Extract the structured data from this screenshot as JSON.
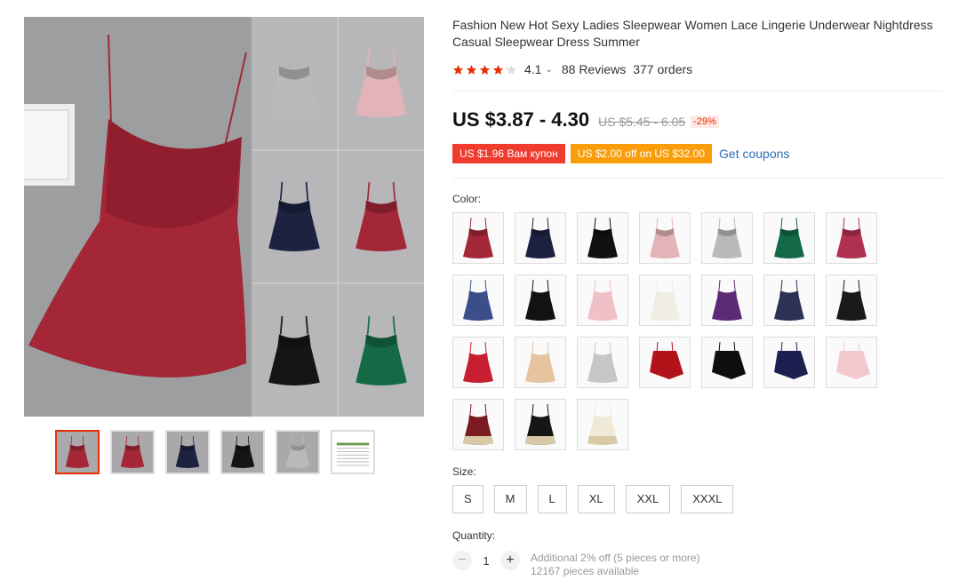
{
  "product": {
    "title": "Fashion New Hot Sexy Ladies Sleepwear Women Lace Lingerie Underwear Nightdress Casual Sleepwear Dress Summer",
    "rating": 4.1,
    "rating_text": "4.1",
    "reviews": "88 Reviews",
    "orders": "377 orders"
  },
  "price": {
    "current": "US $3.87 - 4.30",
    "original": "US $5.45 - 6.05",
    "discount": "-29%"
  },
  "coupons": {
    "coupon1": "US $1.96 Вам купон",
    "coupon2": "US $2.00 off on US $32.00",
    "get_label": "Get coupons"
  },
  "color_label": "Color:",
  "colors": [
    {
      "name": "wine-red",
      "hex": "#a32737",
      "style": "lace"
    },
    {
      "name": "navy",
      "hex": "#1d2240",
      "style": "lace"
    },
    {
      "name": "black",
      "hex": "#111111",
      "style": "lace"
    },
    {
      "name": "pink",
      "hex": "#e2b4b8",
      "style": "lace"
    },
    {
      "name": "gray",
      "hex": "#b9b9bb",
      "style": "lace"
    },
    {
      "name": "green",
      "hex": "#146a46",
      "style": "lace"
    },
    {
      "name": "rose",
      "hex": "#b0304f",
      "style": "lace"
    },
    {
      "name": "blue",
      "hex": "#3a4e8a",
      "style": "plain"
    },
    {
      "name": "black-2",
      "hex": "#121212",
      "style": "plain"
    },
    {
      "name": "light-pink",
      "hex": "#efc0c8",
      "style": "plain"
    },
    {
      "name": "white",
      "hex": "#f0ede4",
      "style": "plain"
    },
    {
      "name": "purple",
      "hex": "#5d2a78",
      "style": "plain"
    },
    {
      "name": "dark-navy",
      "hex": "#2b3255",
      "style": "plain"
    },
    {
      "name": "black-3",
      "hex": "#1a1a1a",
      "style": "plain"
    },
    {
      "name": "red",
      "hex": "#c61f32",
      "style": "plain"
    },
    {
      "name": "champagne",
      "hex": "#e6c4a0",
      "style": "plain"
    },
    {
      "name": "silver",
      "hex": "#c6c6c6",
      "style": "plain"
    },
    {
      "name": "red-2",
      "hex": "#b4121a",
      "style": "flat"
    },
    {
      "name": "black-4",
      "hex": "#0e0e0e",
      "style": "flat"
    },
    {
      "name": "navy-2",
      "hex": "#1c2050",
      "style": "flat"
    },
    {
      "name": "pink-2",
      "hex": "#f2c8cf",
      "style": "flat"
    },
    {
      "name": "burgundy-lace",
      "hex": "#7c1a22",
      "style": "hem"
    },
    {
      "name": "black-lace",
      "hex": "#161616",
      "style": "hem"
    },
    {
      "name": "ivory-lace",
      "hex": "#efe9d8",
      "style": "hem"
    }
  ],
  "size_label": "Size:",
  "sizes": [
    "S",
    "M",
    "L",
    "XL",
    "XXL",
    "XXXL"
  ],
  "quantity_label": "Quantity:",
  "quantity": {
    "value": "1",
    "additional": "Additional 2% off (5 pieces or more)",
    "available": "12167 pieces available"
  },
  "gallery": {
    "main_colors": [
      "#a32737"
    ],
    "grid_colors": [
      "#b9b9bb",
      "#e2b4b8",
      "#1d2240",
      "#a32737",
      "#151515",
      "#146a46"
    ],
    "thumbs": [
      {
        "name": "thumb-collage",
        "color": "#a32737",
        "active": true
      },
      {
        "name": "thumb-red",
        "color": "#a32737",
        "active": false
      },
      {
        "name": "thumb-navy",
        "color": "#1d2240",
        "active": false
      },
      {
        "name": "thumb-black",
        "color": "#151515",
        "active": false
      },
      {
        "name": "thumb-gray",
        "color": "#b9b9bb",
        "active": false
      },
      {
        "name": "thumb-size-chart",
        "color": "#ffffff",
        "active": false
      }
    ]
  }
}
